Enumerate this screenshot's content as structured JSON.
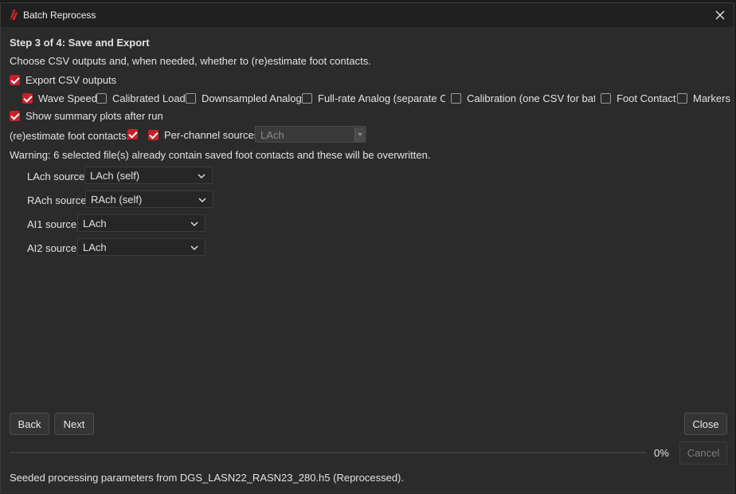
{
  "window": {
    "title": "Batch Reprocess"
  },
  "step": {
    "heading": "Step 3 of 4: Save and Export",
    "description": "Choose CSV outputs and, when needed, whether to (re)estimate foot contacts."
  },
  "export_csv": {
    "label": "Export CSV outputs",
    "checked": true
  },
  "csv_options": [
    {
      "label": "Wave Speed",
      "checked": true
    },
    {
      "label": "Calibrated Load",
      "checked": false
    },
    {
      "label": "Downsampled Analog",
      "checked": false
    },
    {
      "label": "Full-rate Analog (separate CSV",
      "checked": false
    },
    {
      "label": "Calibration (one CSV for batch",
      "checked": false
    },
    {
      "label": "Foot Contact",
      "checked": false
    },
    {
      "label": "Markers",
      "checked": false
    }
  ],
  "summary_plots": {
    "label": "Show summary plots after run",
    "checked": true
  },
  "reestimate": {
    "label": "(re)estimate foot contacts:",
    "checked": true,
    "per_channel_label": "Per-channel sources",
    "per_channel_checked": true,
    "source_value": "LAch"
  },
  "warning": "Warning: 6 selected file(s) already contain saved foot contacts and these will be overwritten.",
  "sources": [
    {
      "label": "LAch source:",
      "value": "LAch (self)"
    },
    {
      "label": "RAch source:",
      "value": "RAch (self)"
    },
    {
      "label": "AI1 source:",
      "value": "LAch"
    },
    {
      "label": "AI2 source:",
      "value": "LAch"
    }
  ],
  "buttons": {
    "back": "Back",
    "next": "Next",
    "close": "Close",
    "cancel": "Cancel"
  },
  "progress": {
    "value": 0,
    "label": "0%"
  },
  "status": "Seeded processing parameters from DGS_LASN22_RASN23_280.h5 (Reprocessed).",
  "colors": {
    "accent": "#c8202b",
    "background": "#2b2b2b",
    "titlebar": "#202020"
  },
  "icons": {
    "logo": "app-logo-icon",
    "close": "close-icon",
    "dropdown": "chevron-down-icon"
  }
}
